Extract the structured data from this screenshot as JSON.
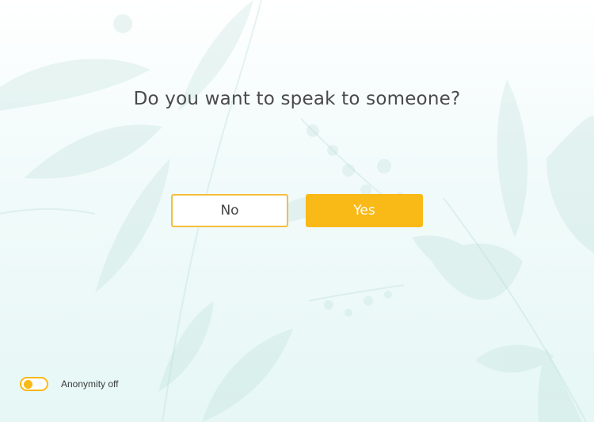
{
  "prompt": {
    "question": "Do you want to speak to someone?"
  },
  "choices": {
    "no_label": "No",
    "yes_label": "Yes"
  },
  "anonymity": {
    "label": "Anonymity off",
    "enabled": false
  },
  "colors": {
    "accent": "#f9b916",
    "text": "#4a4a4a",
    "background_top": "#ffffff",
    "background_bottom": "#e6f7f5",
    "leaf": "#b9ddd6"
  },
  "icons": {
    "background": "leaf-pattern-icon"
  }
}
